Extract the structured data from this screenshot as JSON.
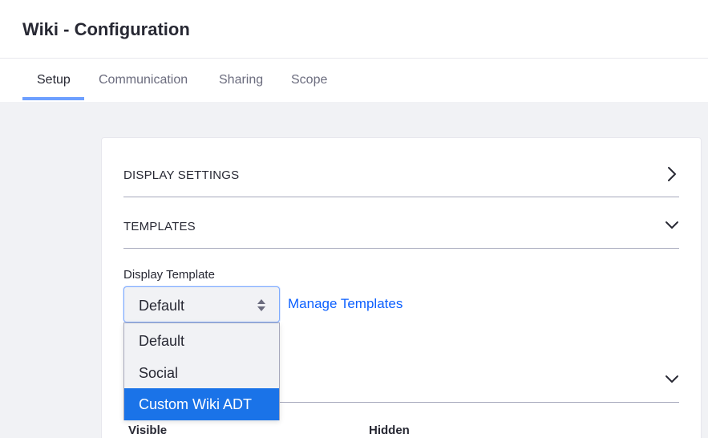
{
  "header": {
    "title": "Wiki - Configuration"
  },
  "tabs": [
    {
      "label": "Setup",
      "active": true
    },
    {
      "label": "Communication",
      "active": false
    },
    {
      "label": "Sharing",
      "active": false
    },
    {
      "label": "Scope",
      "active": false
    }
  ],
  "panels": {
    "display_settings": {
      "label": "DISPLAY SETTINGS",
      "icon": "chevron-right-icon",
      "expanded": false
    },
    "templates": {
      "label": "TEMPLATES",
      "icon": "chevron-down-icon",
      "expanded": true
    },
    "third": {
      "icon": "chevron-down-icon"
    }
  },
  "display_template": {
    "label": "Display Template",
    "value": "Default",
    "manage_link": "Manage Templates",
    "options": [
      "Default",
      "Social",
      "Custom Wiki ADT"
    ],
    "highlighted_option": "Custom Wiki ADT"
  },
  "columns": {
    "visible": "Visible",
    "hidden": "Hidden"
  },
  "colors": {
    "accent": "#0b5fff",
    "highlight": "#1a73e8"
  }
}
